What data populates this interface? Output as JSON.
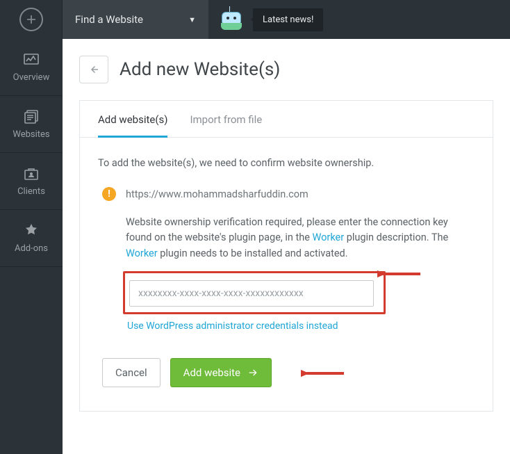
{
  "topbar": {
    "dropdown_label": "Find a Website",
    "news_label": "Latest news!"
  },
  "sidebar": {
    "items": [
      {
        "label": "Overview"
      },
      {
        "label": "Websites"
      },
      {
        "label": "Clients"
      },
      {
        "label": "Add-ons"
      }
    ]
  },
  "page": {
    "title": "Add new Website(s)"
  },
  "tabs": {
    "add": "Add website(s)",
    "import": "Import from file"
  },
  "panel": {
    "intro": "To add the website(s), we need to confirm website ownership.",
    "site_url": "https://www.mohammadsharfuddin.com",
    "verify_pre": "Website ownership verification required, please enter the connection key found on the website's plugin page, in the ",
    "worker": "Worker",
    "verify_mid": " plugin description. The ",
    "verify_post": " plugin needs to be installed and activated.",
    "key_placeholder": "xxxxxxxx-xxxx-xxxx-xxxx-xxxxxxxxxxxx",
    "alt_link": "Use WordPress administrator credentials instead"
  },
  "actions": {
    "cancel": "Cancel",
    "submit": "Add website"
  }
}
